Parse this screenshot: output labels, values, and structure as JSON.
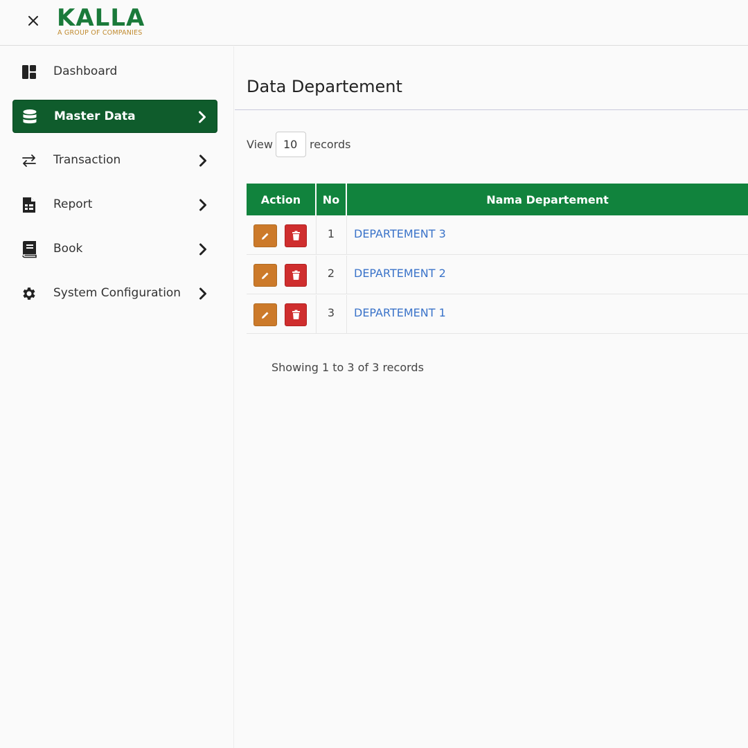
{
  "brand": {
    "name": "KALLA",
    "tagline": "A GROUP OF COMPANIES",
    "color_primary": "#1a7a3a",
    "color_accent": "#c08a2e"
  },
  "topbar": {
    "close_icon": "close-icon"
  },
  "sidebar": {
    "items": [
      {
        "label": "Dashboard",
        "icon": "dashboard-icon",
        "has_chevron": false,
        "active": false
      },
      {
        "label": "Master Data",
        "icon": "database-icon",
        "has_chevron": true,
        "active": true
      },
      {
        "label": "Transaction",
        "icon": "swap-arrows-icon",
        "has_chevron": true,
        "active": false
      },
      {
        "label": "Report",
        "icon": "report-document-icon",
        "has_chevron": true,
        "active": false
      },
      {
        "label": "Book",
        "icon": "book-icon",
        "has_chevron": true,
        "active": false
      },
      {
        "label": "System Configuration",
        "icon": "gear-icon",
        "has_chevron": true,
        "active": false
      }
    ],
    "active_color": "#0f5c2c"
  },
  "main": {
    "title": "Data Departement",
    "view_label": "View",
    "page_size": "10",
    "records_label": "records",
    "table": {
      "header_color": "#11833d",
      "columns": [
        "Action",
        "No",
        "Nama Departement"
      ],
      "rows": [
        {
          "no": "1",
          "nama": "DEPARTEMENT 3"
        },
        {
          "no": "2",
          "nama": "DEPARTEMENT 2"
        },
        {
          "no": "3",
          "nama": "DEPARTEMENT 1"
        }
      ]
    },
    "footer": "Showing 1 to 3 of 3 records"
  }
}
